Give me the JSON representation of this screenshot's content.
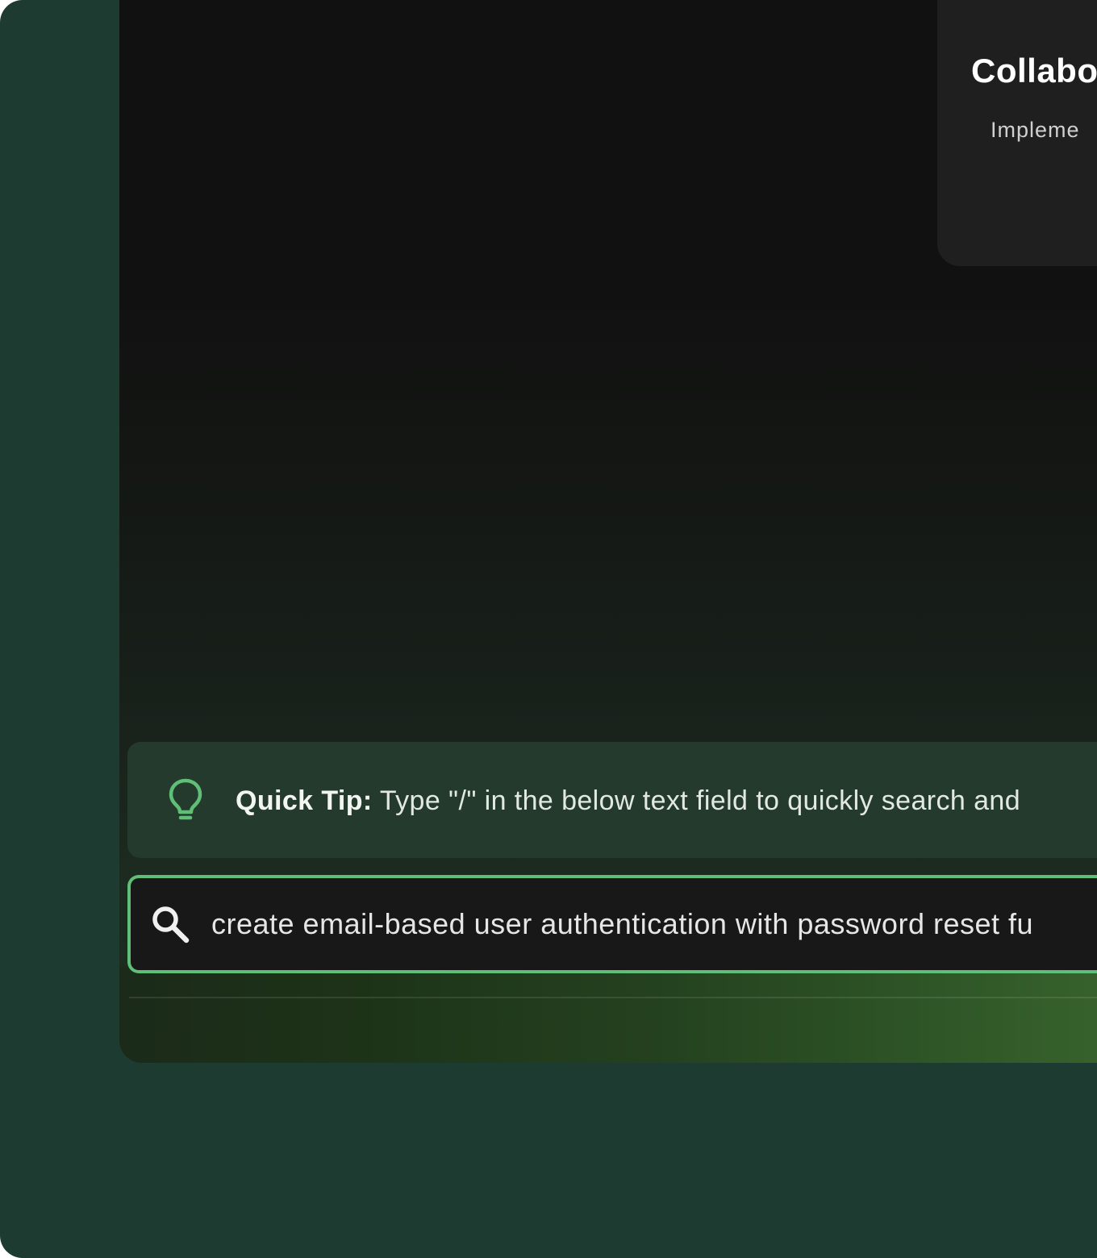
{
  "card": {
    "title": "Collabo",
    "description": "Impleme"
  },
  "tip": {
    "icon": "lightbulb-icon",
    "label": "Quick Tip:",
    "text": " Type \"/\" in the below text field to quickly search and"
  },
  "search": {
    "icon": "search-icon",
    "value": "create email-based user authentication with password reset fu"
  },
  "colors": {
    "outer_background": "#1e3b31",
    "window_background": "#111111",
    "tip_background": "#243a2c",
    "accent": "#5fbf77",
    "input_background": "#181818"
  }
}
